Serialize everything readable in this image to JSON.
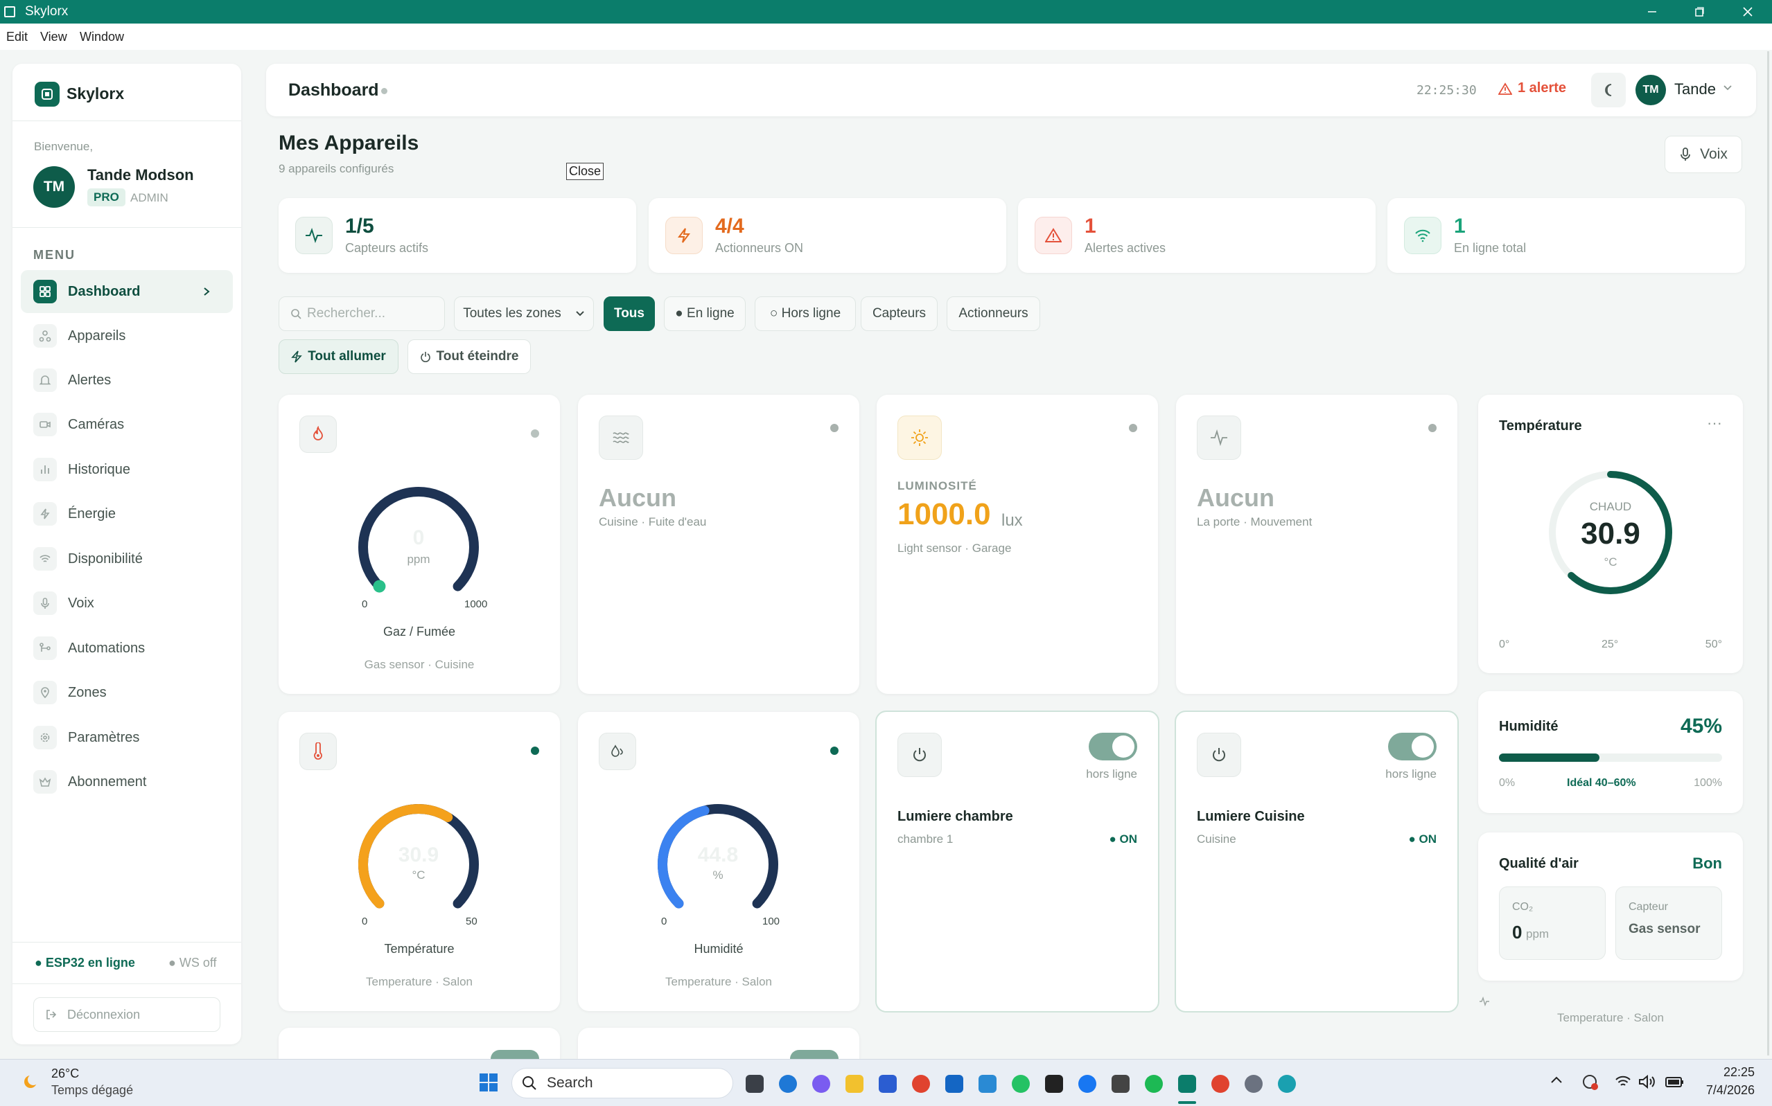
{
  "window": {
    "title": "Skylorx"
  },
  "menubar": {
    "items": [
      "Edit",
      "View",
      "Window"
    ]
  },
  "sidebar": {
    "brand": "Skylorx",
    "welcome": "Bienvenue,",
    "user": {
      "initials": "TM",
      "name": "Tande Modson",
      "plan": "PRO",
      "role": "ADMIN"
    },
    "menu_label": "MENU",
    "items": [
      {
        "label": "Dashboard",
        "icon": "grid-icon",
        "active": true
      },
      {
        "label": "Appareils",
        "icon": "devices-icon"
      },
      {
        "label": "Alertes",
        "icon": "bell-icon"
      },
      {
        "label": "Caméras",
        "icon": "camera-icon"
      },
      {
        "label": "Historique",
        "icon": "bar-chart-icon"
      },
      {
        "label": "Énergie",
        "icon": "bolt-icon"
      },
      {
        "label": "Disponibilité",
        "icon": "wifi-icon"
      },
      {
        "label": "Voix",
        "icon": "mic-icon"
      },
      {
        "label": "Automations",
        "icon": "flow-icon"
      },
      {
        "label": "Zones",
        "icon": "pin-icon"
      },
      {
        "label": "Paramètres",
        "icon": "gear-icon"
      },
      {
        "label": "Abonnement",
        "icon": "crown-icon"
      }
    ],
    "status_online": "ESP32 en ligne",
    "status_ws": "WS off",
    "logout": "Déconnexion"
  },
  "header": {
    "title": "Dashboard",
    "time": "22:25:30",
    "alert": "1 alerte",
    "user_initials": "TM",
    "user_name": "Tande"
  },
  "page": {
    "title": "Mes Appareils",
    "subtitle": "9 appareils configurés",
    "close_label": "Close",
    "voice_label": "Voix"
  },
  "stats": [
    {
      "value": "1/5",
      "label": "Capteurs actifs",
      "color": "#0e6a55"
    },
    {
      "value": "4/4",
      "label": "Actionneurs ON",
      "color": "#e36a1e"
    },
    {
      "value": "1",
      "label": "Alertes actives",
      "color": "#e4513a"
    },
    {
      "value": "1",
      "label": "En ligne total",
      "color": "#1aa37a"
    }
  ],
  "filters": {
    "search_placeholder": "Rechercher...",
    "zone_select": "Toutes les zones",
    "chips": [
      "Tous",
      "● En ligne",
      "○ Hors ligne",
      "Capteurs",
      "Actionneurs"
    ],
    "all_on": "Tout allumer",
    "all_off": "Tout éteindre"
  },
  "cards": {
    "gas": {
      "value": "0",
      "unit": "ppm",
      "min": "0",
      "max": "1000",
      "name": "Gaz / Fumée",
      "location": "Gas sensor · Cuisine",
      "fraction": 0.0
    },
    "water": {
      "value": "Aucun",
      "sub": "Cuisine · Fuite d'eau"
    },
    "light": {
      "label": "LUMINOSITÉ",
      "value": "1000.0",
      "unit": "lux",
      "sub": "Light sensor · Garage"
    },
    "motion": {
      "value": "Aucun",
      "sub": "La porte · Mouvement"
    },
    "temp": {
      "value": "30.9",
      "unit": "°C",
      "min": "0",
      "max": "50",
      "name": "Température",
      "location": "Temperature · Salon",
      "fraction": 0.618
    },
    "hum": {
      "value": "44.8",
      "unit": "%",
      "min": "0",
      "max": "100",
      "name": "Humidité",
      "location": "Temperature · Salon",
      "fraction": 0.448
    },
    "lamp1": {
      "status": "hors ligne",
      "name": "Lumiere chambre",
      "room": "chambre 1",
      "state": "● ON"
    },
    "lamp2": {
      "status": "hors ligne",
      "name": "Lumiere Cuisine",
      "room": "Cuisine",
      "state": "● ON"
    }
  },
  "right": {
    "temp": {
      "title": "Température",
      "state": "CHAUD",
      "value": "30.9",
      "unit": "°C",
      "ticks": [
        "0°",
        "25°",
        "50°"
      ],
      "fraction": 0.618
    },
    "hum": {
      "title": "Humidité",
      "value": "45%",
      "min": "0%",
      "ideal": "Idéal 40–60%",
      "max": "100%",
      "fraction": 0.45
    },
    "air": {
      "title": "Qualité d'air",
      "quality": "Bon",
      "co2_label": "CO₂",
      "co2_value": "0",
      "co2_unit": "ppm",
      "sensor_label": "Capteur",
      "sensor_value": "Gas sensor"
    },
    "footer": "Temperature · Salon"
  },
  "taskbar": {
    "weather_temp": "26°C",
    "weather_desc": "Temps dégagé",
    "search": "Search",
    "time": "22:25",
    "date": "7/4/2026"
  }
}
